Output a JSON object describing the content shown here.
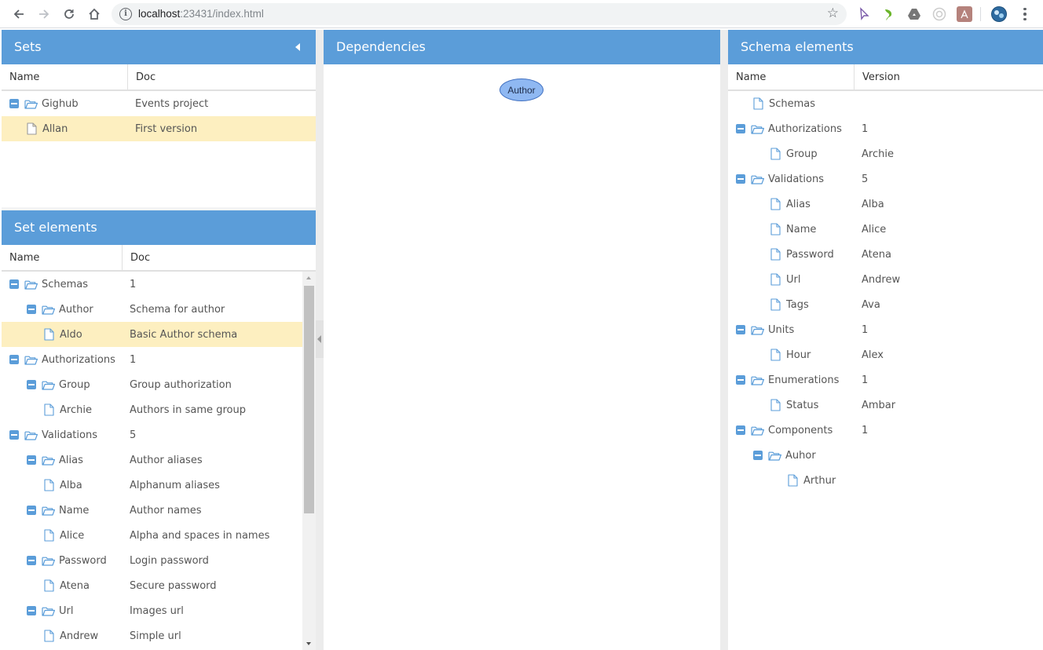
{
  "browser": {
    "url_host": "localhost",
    "url_path": ":23431/index.html",
    "extensions": [
      "cursor-extension-icon",
      "leaf-extension-icon",
      "drive-icon",
      "camera-extension-icon",
      "pdf-extension-icon",
      "profile-avatar"
    ]
  },
  "sets": {
    "title": "Sets",
    "columns": [
      "Name",
      "Doc"
    ],
    "rows": [
      {
        "name": "Gighub",
        "doc": "Events project",
        "type": "folder",
        "level": 0,
        "selected": false
      },
      {
        "name": "Allan",
        "doc": "First version",
        "type": "file",
        "level": 1,
        "selected": true
      }
    ]
  },
  "set_elements": {
    "title": "Set elements",
    "columns": [
      "Name",
      "Doc"
    ],
    "rows": [
      {
        "name": "Schemas",
        "doc": "1",
        "type": "folder",
        "level": 0,
        "selected": false
      },
      {
        "name": "Author",
        "doc": "Schema for author",
        "type": "folder",
        "level": 1,
        "selected": false
      },
      {
        "name": "Aldo",
        "doc": "Basic Author schema",
        "type": "file",
        "level": 2,
        "selected": true
      },
      {
        "name": "Authorizations",
        "doc": "1",
        "type": "folder",
        "level": 0,
        "selected": false
      },
      {
        "name": "Group",
        "doc": "Group authorization",
        "type": "folder",
        "level": 1,
        "selected": false
      },
      {
        "name": "Archie",
        "doc": "Authors in same group",
        "type": "file",
        "level": 2,
        "selected": false
      },
      {
        "name": "Validations",
        "doc": "5",
        "type": "folder",
        "level": 0,
        "selected": false
      },
      {
        "name": "Alias",
        "doc": "Author aliases",
        "type": "folder",
        "level": 1,
        "selected": false
      },
      {
        "name": "Alba",
        "doc": "Alphanum aliases",
        "type": "file",
        "level": 2,
        "selected": false
      },
      {
        "name": "Name",
        "doc": "Author names",
        "type": "folder",
        "level": 1,
        "selected": false
      },
      {
        "name": "Alice",
        "doc": "Alpha and spaces in names",
        "type": "file",
        "level": 2,
        "selected": false
      },
      {
        "name": "Password",
        "doc": "Login password",
        "type": "folder",
        "level": 1,
        "selected": false
      },
      {
        "name": "Atena",
        "doc": "Secure password",
        "type": "file",
        "level": 2,
        "selected": false
      },
      {
        "name": "Url",
        "doc": "Images url",
        "type": "folder",
        "level": 1,
        "selected": false
      },
      {
        "name": "Andrew",
        "doc": "Simple url",
        "type": "file",
        "level": 2,
        "selected": false
      }
    ]
  },
  "dependencies": {
    "title": "Dependencies",
    "nodes": [
      "Author"
    ]
  },
  "schema_elements": {
    "title": "Schema elements",
    "columns": [
      "Name",
      "Version"
    ],
    "rows": [
      {
        "name": "Schemas",
        "doc": "",
        "type": "file",
        "level": 1,
        "selected": false
      },
      {
        "name": "Authorizations",
        "doc": "1",
        "type": "folder",
        "level": 0,
        "selected": false
      },
      {
        "name": "Group",
        "doc": "Archie",
        "type": "file",
        "level": 2,
        "selected": false
      },
      {
        "name": "Validations",
        "doc": "5",
        "type": "folder",
        "level": 0,
        "selected": false
      },
      {
        "name": "Alias",
        "doc": "Alba",
        "type": "file",
        "level": 2,
        "selected": false
      },
      {
        "name": "Name",
        "doc": "Alice",
        "type": "file",
        "level": 2,
        "selected": false
      },
      {
        "name": "Password",
        "doc": "Atena",
        "type": "file",
        "level": 2,
        "selected": false
      },
      {
        "name": "Url",
        "doc": "Andrew",
        "type": "file",
        "level": 2,
        "selected": false
      },
      {
        "name": "Tags",
        "doc": "Ava",
        "type": "file",
        "level": 2,
        "selected": false
      },
      {
        "name": "Units",
        "doc": "1",
        "type": "folder",
        "level": 0,
        "selected": false
      },
      {
        "name": "Hour",
        "doc": "Alex",
        "type": "file",
        "level": 2,
        "selected": false
      },
      {
        "name": "Enumerations",
        "doc": "1",
        "type": "folder",
        "level": 0,
        "selected": false
      },
      {
        "name": "Status",
        "doc": "Ambar",
        "type": "file",
        "level": 2,
        "selected": false
      },
      {
        "name": "Components",
        "doc": "1",
        "type": "folder",
        "level": 0,
        "selected": false
      },
      {
        "name": "Auhor",
        "doc": "",
        "type": "folder",
        "level": 1,
        "selected": false
      },
      {
        "name": "Arthur",
        "doc": "",
        "type": "file",
        "level": 3,
        "selected": false
      }
    ]
  },
  "colors": {
    "header_blue": "#5b9dd9",
    "selected_row": "#fdefc0",
    "icon_blue": "#5b9dd9"
  }
}
